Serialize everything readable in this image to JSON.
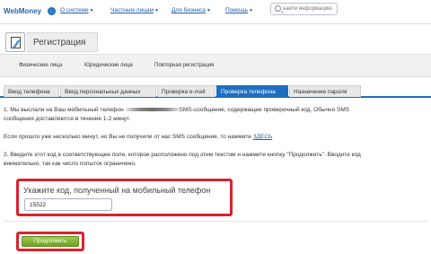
{
  "header": {
    "logo_text": "WebMoney",
    "nav": [
      {
        "label": "О системе"
      },
      {
        "label": "Частным лицам"
      },
      {
        "label": "Для бизнеса"
      },
      {
        "label": "Помощь"
      }
    ],
    "search_placeholder": "найти информацию"
  },
  "registration": {
    "title": "Регистрация",
    "subtabs": [
      "Физические лица",
      "Юридические лица",
      "Повторная регистрация"
    ]
  },
  "steps": [
    {
      "label": "Ввод телефона",
      "active": false
    },
    {
      "label": "Ввод персональных данных",
      "active": false
    },
    {
      "label": "Проверка e-mail",
      "active": false
    },
    {
      "label": "Проверка телефона",
      "active": true
    },
    {
      "label": "Назначение пароля",
      "active": false
    }
  ],
  "content": {
    "p1_start": "1. Мы выслали на Ваш мобильный телефон",
    "p1_end": "SMS-сообщение, содержащее проверочный код. Обычно SMS",
    "p1_line2": "сообщения доставляются в течение 1-2 минут.",
    "p2_start": "Если прошло уже несколько минут, но Вы не получили от нас SMS сообщение, то нажмите",
    "p2_link": "ЗДЕСЬ",
    "p3_line1": "2. Введите этот код в соответствующее поле, которое расположено под этим текстом и нажмите кнопку \"Продолжить\". Вводите код",
    "p3_line2": "внимательно, так как число попыток ограничено.",
    "code_label": "Укажите код, полученный на мобильный телефон",
    "code_value": "15522",
    "continue_label": "Продолжить"
  },
  "colors": {
    "accent_blue": "#1e6ec0",
    "highlight_red": "#d9232f",
    "button_green": "#7fb032"
  }
}
